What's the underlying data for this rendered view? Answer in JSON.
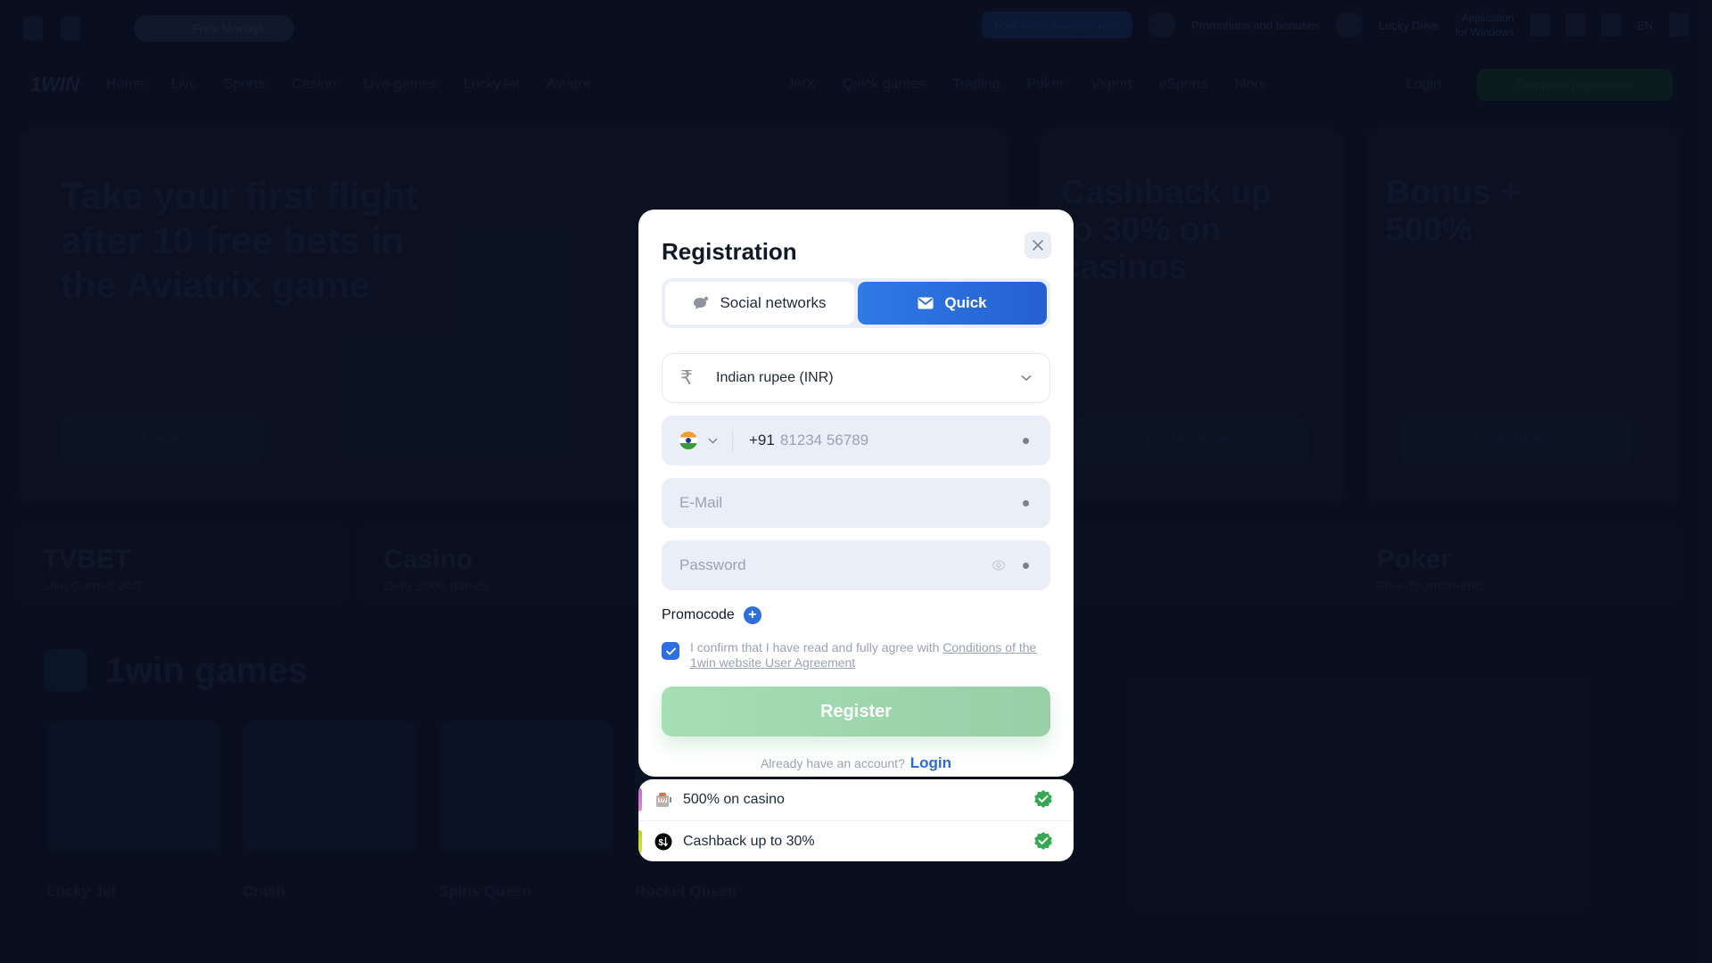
{
  "background": {
    "topbar": {
      "free_money": "Free Money!",
      "pills": [
        "Free Point Sweepstakes",
        "Promotions and bonuses",
        "Lucky Drive"
      ],
      "app_label_line1": "Application",
      "app_label_line2": "for Windows",
      "language": "EN"
    },
    "navbar": {
      "logo": "1WIN",
      "items": [
        "Home",
        "Live",
        "Sports",
        "Casino",
        "Live-games",
        "LuckyJet",
        "Aviator",
        "JetX",
        "Quick games",
        "Trading",
        "Poker",
        "Vsport",
        "eSports",
        "More"
      ],
      "login": "Login",
      "register": "Complete registration"
    },
    "banners": [
      {
        "title": "Take your first flight after 10 free bets in the Aviatrix game",
        "button": "Claim"
      },
      {
        "title": "Cashback up to 30% on casinos",
        "button": "Go to casino"
      },
      {
        "title": "Bonus + 500%",
        "button": "Registration"
      }
    ],
    "categories": [
      {
        "title": "TVBET",
        "subtitle": "Live Games 24/7"
      },
      {
        "title": "Casino",
        "subtitle": "Over 3000 games"
      },
      {
        "title": "Poker",
        "subtitle": "Free Tournaments"
      }
    ],
    "games_section": {
      "title": "1win games",
      "games": [
        "Lucky Jet",
        "Crash",
        "Spins Queen",
        "Rocket Queen"
      ]
    }
  },
  "modal": {
    "title": "Registration",
    "tabs": [
      {
        "label": "Social networks",
        "icon": "chat-bubble-icon",
        "active": false
      },
      {
        "label": "Quick",
        "icon": "envelope-icon",
        "active": true
      }
    ],
    "currency": {
      "icon": "rupee-icon",
      "value": "Indian rupee (INR)"
    },
    "phone": {
      "country": "India",
      "prefix": "+91",
      "placeholder": "81234 56789"
    },
    "email": {
      "placeholder": "E-Mail"
    },
    "password": {
      "placeholder": "Password"
    },
    "promocode_label": "Promocode",
    "agreement": {
      "checked": true,
      "text": "I confirm that I have read and fully agree with ",
      "link": "Conditions of the 1win website User Agreement"
    },
    "register_button": "Register",
    "already_text": "Already have an account?",
    "login_link": "Login"
  },
  "bonuses": [
    {
      "icon": "slot-machine-icon",
      "label": "500% on casino",
      "bar_color": "#c86ad8",
      "checked": true
    },
    {
      "icon": "cashback-icon",
      "label": "Cashback up to 30%",
      "bar_color": "#b5d81a",
      "checked": true
    }
  ],
  "colors": {
    "accent_blue": "#2f6fdc",
    "register_green": "#a6dfb4",
    "check_green": "#34a853"
  }
}
